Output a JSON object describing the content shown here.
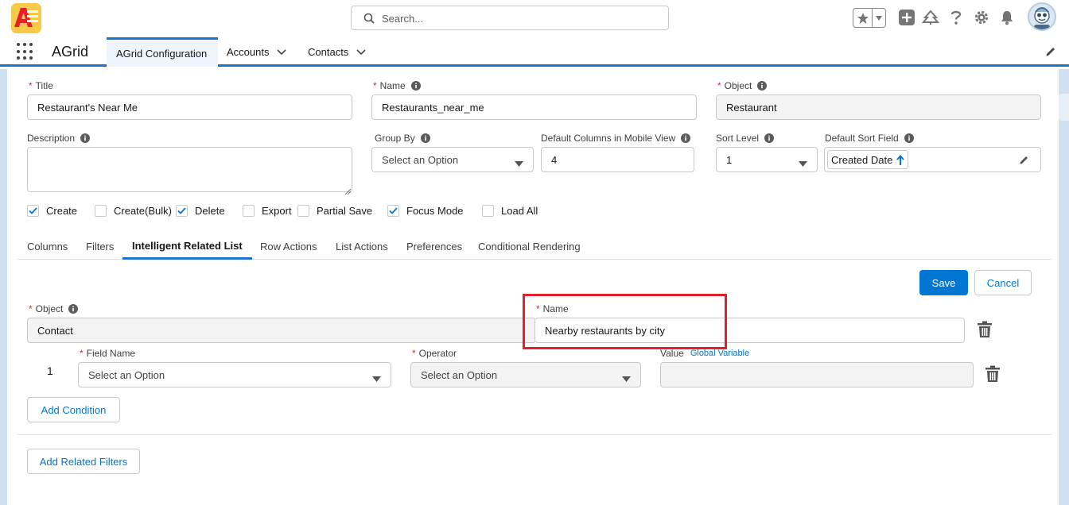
{
  "header": {
    "search_placeholder": "Search...",
    "icons": [
      "app-logo",
      "search-icon",
      "star-icon",
      "chevron-down-icon",
      "plus-icon",
      "trailhead-icon",
      "help-icon",
      "gear-icon",
      "bell-icon",
      "avatar"
    ]
  },
  "nav": {
    "app_name": "AGrid",
    "tabs": [
      {
        "label": "AGrid Configuration",
        "active": true
      },
      {
        "label": "Accounts",
        "has_menu": true
      },
      {
        "label": "Contacts",
        "has_menu": true
      }
    ]
  },
  "form": {
    "title": {
      "label": "Title",
      "required": true,
      "value": "Restaurant's Near Me"
    },
    "name": {
      "label": "Name",
      "required": true,
      "value": "Restaurants_near_me"
    },
    "object": {
      "label": "Object",
      "required": true,
      "value": "Restaurant"
    },
    "description": {
      "label": "Description",
      "value": ""
    },
    "group_by": {
      "label": "Group By",
      "value": "Select an Option"
    },
    "default_columns_mobile": {
      "label": "Default Columns in Mobile View",
      "value": "4"
    },
    "sort_level": {
      "label": "Sort Level",
      "value": "1"
    },
    "default_sort_field": {
      "label": "Default Sort Field",
      "value": "Created Date"
    }
  },
  "checkboxes": [
    {
      "label": "Create",
      "checked": true
    },
    {
      "label": "Create(Bulk)",
      "checked": false
    },
    {
      "label": "Delete",
      "checked": true
    },
    {
      "label": "Export",
      "checked": false
    },
    {
      "label": "Partial Save",
      "checked": false
    },
    {
      "label": "Focus Mode",
      "checked": true
    },
    {
      "label": "Load All",
      "checked": false
    }
  ],
  "tabs": [
    {
      "label": "Columns"
    },
    {
      "label": "Filters"
    },
    {
      "label": "Intelligent Related List",
      "active": true
    },
    {
      "label": "Row Actions"
    },
    {
      "label": "List Actions"
    },
    {
      "label": "Preferences"
    },
    {
      "label": "Conditional Rendering"
    }
  ],
  "related_list": {
    "save_label": "Save",
    "cancel_label": "Cancel",
    "object": {
      "label": "Object",
      "required": true,
      "value": "Contact"
    },
    "name": {
      "label": "Name",
      "required": true,
      "value": "Nearby restaurants by city"
    },
    "condition": {
      "row_number": "1",
      "field_name": {
        "label": "Field Name",
        "required": true,
        "value": "Select an Option"
      },
      "operator": {
        "label": "Operator",
        "required": true,
        "value": "Select an Option"
      },
      "value": {
        "label": "Value",
        "link": "Global Variable",
        "value": ""
      }
    },
    "add_condition_label": "Add Condition",
    "add_related_filters_label": "Add Related Filters"
  },
  "colors": {
    "brand": "#0176d3",
    "nav_accent": "#1b74c9",
    "highlight": "#e0202d",
    "required": "#c23934"
  }
}
